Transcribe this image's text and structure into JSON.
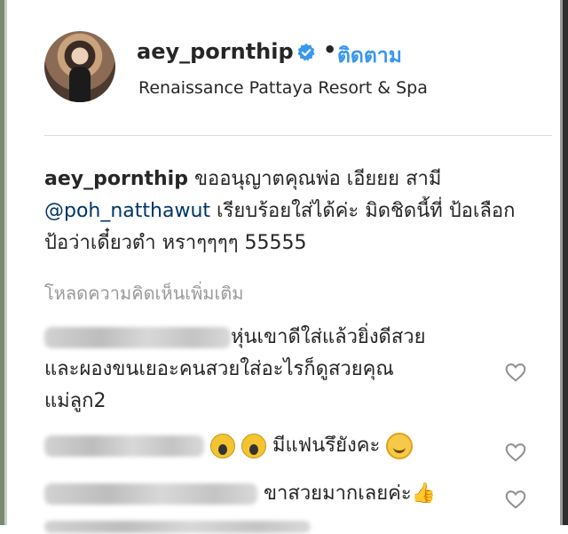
{
  "post": {
    "username": "aey_pornthip",
    "separator": "•",
    "follow_label": "ติดตาม",
    "location": "Renaissance Pattaya Resort & Spa"
  },
  "caption": {
    "username": "aey_pornthip",
    "text_part1": " ขออนุญาตคุณพ่อ เอียยย สามี ",
    "mention": "@poh_natthawut",
    "text_part2": " เรียบร้อยใส่ได้ค่ะ มิดชิดนี้ที่ ป้อเลือก ป้อว่าเดี๋ยวตำ หราๆๆๆๆ 55555"
  },
  "load_more_label": "โหลดความคิดเห็นเพิ่มเติม",
  "comments": [
    {
      "text_line1": "หุ่นเขาดีใส่แล้วยิ่งดีสวย",
      "text_line2": "และผองขนเยอะคนสวยใส่อะไรก็ดูสวยคุณ",
      "text_line3": "แม่ลูก2"
    },
    {
      "text": " มีแฟนรึยังคะ "
    },
    {
      "text": "ขาสวยมากเลยค่ะ"
    }
  ],
  "icons": {
    "verified": "verified-badge-icon",
    "heart": "heart-outline-icon",
    "emoji_scream": "face-screaming-icon",
    "emoji_smile": "smiling-face-icon",
    "thumb": "thumbs-up-icon"
  },
  "colors": {
    "link": "#3897f0",
    "mention": "#003569",
    "muted": "#999999",
    "text": "#262626"
  }
}
